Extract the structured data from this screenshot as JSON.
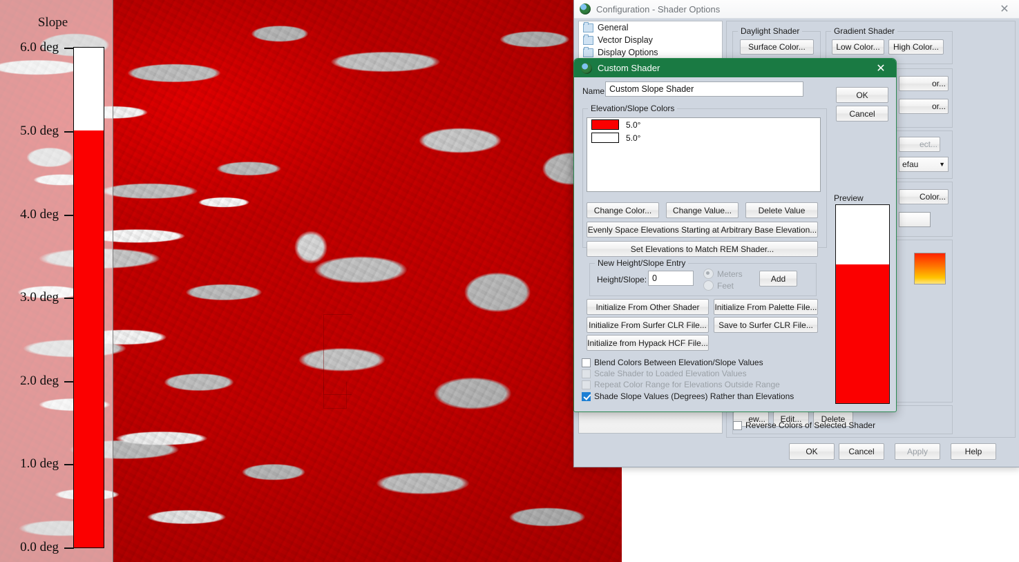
{
  "legend": {
    "title": "Slope",
    "unit": "deg",
    "ticks": [
      {
        "label": "6.0 deg",
        "value": 6.0
      },
      {
        "label": "5.0 deg",
        "value": 5.0
      },
      {
        "label": "4.0 deg",
        "value": 4.0
      },
      {
        "label": "3.0 deg",
        "value": 3.0
      },
      {
        "label": "2.0 deg",
        "value": 2.0
      },
      {
        "label": "1.0 deg",
        "value": 1.0
      },
      {
        "label": "0.0 deg",
        "value": 0.0
      }
    ],
    "colors": {
      "high": "#ffffff",
      "low": "#fb0000",
      "breakpoint": 5.0
    }
  },
  "config_window": {
    "title": "Configuration - Shader Options",
    "close_label": "✕",
    "tree_items": [
      {
        "label": "General"
      },
      {
        "label": "Vector Display"
      },
      {
        "label": "Display Options"
      }
    ],
    "daylight_shader": {
      "title": "Daylight Shader",
      "surface_color": "Surface Color..."
    },
    "gradient_shader": {
      "title": "Gradient Shader",
      "low_color": "Low Color...",
      "high_color": "High Color..."
    },
    "hidden_buttons": {
      "b1": "or...",
      "b2": "or...",
      "b3": "ect...",
      "b4": "efau",
      "b5": "Color...",
      "b6": "ew...",
      "edit": "Edit...",
      "delete": "Delete"
    },
    "reverse_colors_label": "Reverse Colors of Selected Shader",
    "reverse_colors_checked": false,
    "buttons": {
      "ok": "OK",
      "cancel": "Cancel",
      "apply": "Apply",
      "help": "Help"
    },
    "apply_enabled": false
  },
  "custom_shader": {
    "title": "Custom Shader",
    "close_label": "✕",
    "name_label": "Name",
    "name_value": "Custom Slope Shader",
    "colors_group_title": "Elevation/Slope Colors",
    "color_entries": [
      {
        "color": "#fb0000",
        "value": "5.0°"
      },
      {
        "color": "#ffffff",
        "value": "5.0°"
      }
    ],
    "buttons": {
      "change_color": "Change Color...",
      "change_value": "Change Value...",
      "delete_value": "Delete Value",
      "evenly_space": "Evenly Space Elevations Starting at Arbitrary Base Elevation...",
      "set_rem": "Set Elevations to Match REM Shader...",
      "add": "Add",
      "init_other": "Initialize From Other Shader",
      "init_palette": "Initialize From Palette File...",
      "init_surfer": "Initialize From Surfer CLR File...",
      "save_surfer": "Save to Surfer CLR File...",
      "init_hypack": "Initialize from Hypack HCF File...",
      "ok": "OK",
      "cancel": "Cancel"
    },
    "new_entry": {
      "group_title": "New Height/Slope Entry",
      "field_label": "Height/Slope:",
      "field_value": "0",
      "units": [
        {
          "label": "Meters",
          "selected": true
        },
        {
          "label": "Feet",
          "selected": false
        }
      ]
    },
    "preview_label": "Preview",
    "preview": {
      "top_color": "#ffffff",
      "bottom_color": "#fb0000",
      "split_pct": 30
    },
    "checkboxes": [
      {
        "label": "Blend Colors Between Elevation/Slope Values",
        "checked": false,
        "enabled": true
      },
      {
        "label": "Scale Shader to Loaded Elevation Values",
        "checked": false,
        "enabled": false
      },
      {
        "label": "Repeat Color Range for Elevations Outside Range",
        "checked": false,
        "enabled": false
      },
      {
        "label": "Shade Slope Values (Degrees) Rather than Elevations",
        "checked": true,
        "enabled": true
      }
    ]
  }
}
